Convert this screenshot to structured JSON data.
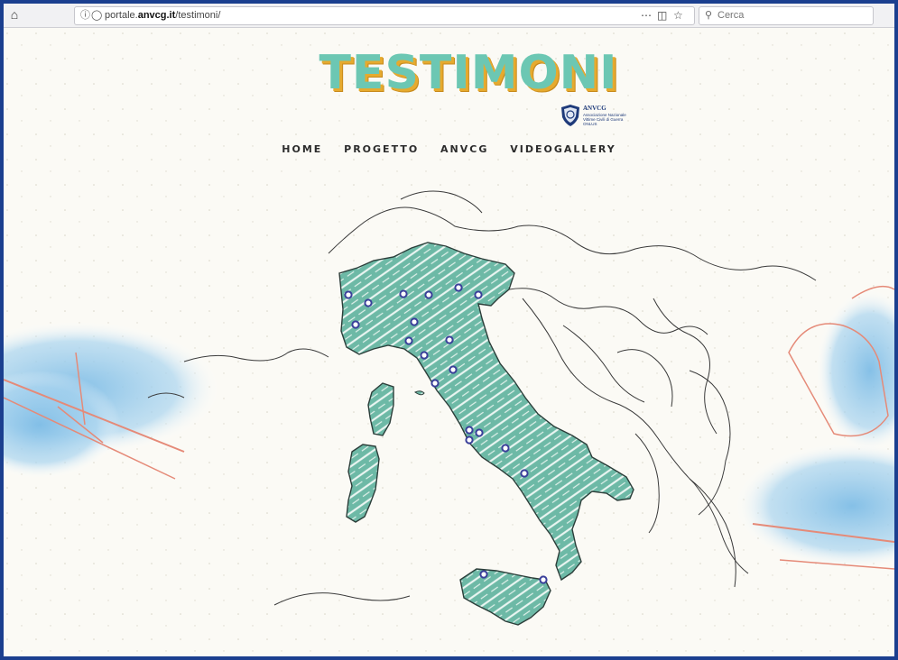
{
  "browser": {
    "url_prefix": "portale.",
    "url_domain": "anvcg.it",
    "url_path": "/testimoni/",
    "search_placeholder": "Cerca"
  },
  "header": {
    "title": "TESTIMONI",
    "logo_name": "ANVCG",
    "logo_subtitle": "Associazione Nazionale Vittime Civili di Guerra ONLUS"
  },
  "nav": [
    "HOME",
    "PROGETTO",
    "ANVCG",
    "VIDEOGALLERY"
  ],
  "colors": {
    "title": "#6cc7b3",
    "title_shadow": "#e6aa2e",
    "map_fill": "#6db9a6",
    "marker_stroke": "#3a3f9a",
    "watercolor_blue": "#8ec6e8"
  },
  "map": {
    "markers_count": 24
  }
}
